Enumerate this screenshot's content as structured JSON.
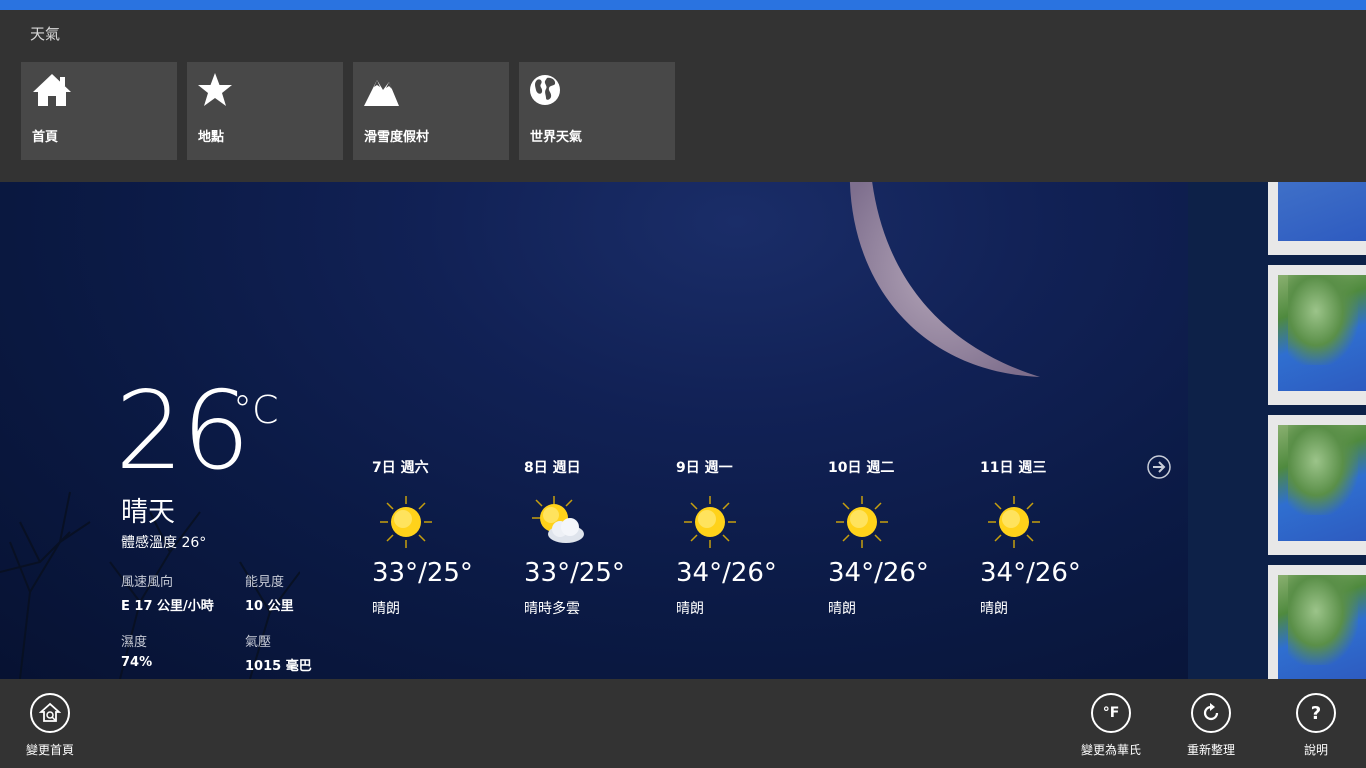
{
  "app": {
    "title": "天氣",
    "accent_color": "#2a73e0"
  },
  "nav": {
    "tiles": [
      {
        "label": "首頁",
        "icon": "home-icon"
      },
      {
        "label": "地點",
        "icon": "star-icon"
      },
      {
        "label": "滑雪度假村",
        "icon": "mountain-icon"
      },
      {
        "label": "世界天氣",
        "icon": "globe-icon"
      }
    ]
  },
  "current": {
    "temp": "26",
    "unit": "°C",
    "condition": "晴天",
    "feels_like": "體感溫度 26°",
    "wind_label": "風速風向",
    "wind_value": "E 17 公里/小時",
    "visibility_label": "能見度",
    "visibility_value": "10 公里",
    "humidity_label": "濕度",
    "humidity_value": "74%",
    "pressure_label": "氣壓",
    "pressure_value": "1015 毫巴"
  },
  "forecast": [
    {
      "date": "7日 週六",
      "temps": "33°/25°",
      "condition": "晴朗",
      "icon": "sun-icon"
    },
    {
      "date": "8日 週日",
      "temps": "33°/25°",
      "condition": "晴時多雲",
      "icon": "partly-cloudy-icon"
    },
    {
      "date": "9日 週一",
      "temps": "34°/26°",
      "condition": "晴朗",
      "icon": "sun-icon"
    },
    {
      "date": "10日 週二",
      "temps": "34°/26°",
      "condition": "晴朗",
      "icon": "sun-icon"
    },
    {
      "date": "11日 週三",
      "temps": "34°/26°",
      "condition": "晴朗",
      "icon": "sun-icon"
    }
  ],
  "app_bar": {
    "change_home": "變更首頁",
    "to_fahrenheit": "變更為華氏",
    "refresh": "重新整理",
    "help": "說明",
    "fahrenheit_glyph": "°F",
    "help_glyph": "?"
  }
}
